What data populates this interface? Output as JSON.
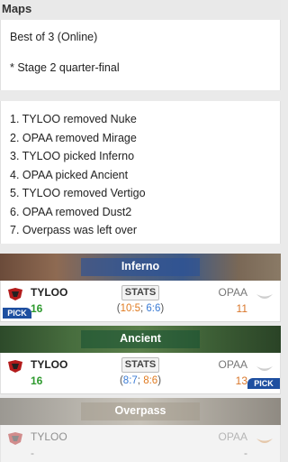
{
  "header": {
    "title": "Maps"
  },
  "match": {
    "format": "Best of 3 (Online)",
    "stage": "* Stage 2 quarter-final"
  },
  "veto": [
    "1. TYLOO removed Nuke",
    "2. OPAA removed Mirage",
    "3. TYLOO picked Inferno",
    "4. OPAA picked Ancient",
    "5. TYLOO removed Vertigo",
    "6. OPAA removed Dust2",
    "7. Overpass was left over"
  ],
  "common": {
    "stats_label": "STATS",
    "pick_label": "PICK",
    "dash": "-"
  },
  "maps": [
    {
      "name": "Inferno",
      "left": {
        "team": "TYLOO",
        "score": "16"
      },
      "right": {
        "team": "OPAA",
        "score": "11"
      },
      "halves": {
        "open": "(",
        "t": "10:5",
        "sep": "; ",
        "ct": "6:6",
        "close": ")"
      }
    },
    {
      "name": "Ancient",
      "left": {
        "team": "TYLOO",
        "score": "16"
      },
      "right": {
        "team": "OPAA",
        "score": "13"
      },
      "halves": {
        "open": "(",
        "t": "8:7",
        "sep": "; ",
        "ct": "8:6",
        "close": ")"
      }
    },
    {
      "name": "Overpass",
      "left": {
        "team": "TYLOO"
      },
      "right": {
        "team": "OPAA"
      }
    }
  ],
  "colors": {
    "win": "#2e9a2e",
    "loss": "#d9772b",
    "t_side": "#e07a1f",
    "ct_side": "#3a7bd5",
    "pick_badge": "#1e4fa0"
  }
}
